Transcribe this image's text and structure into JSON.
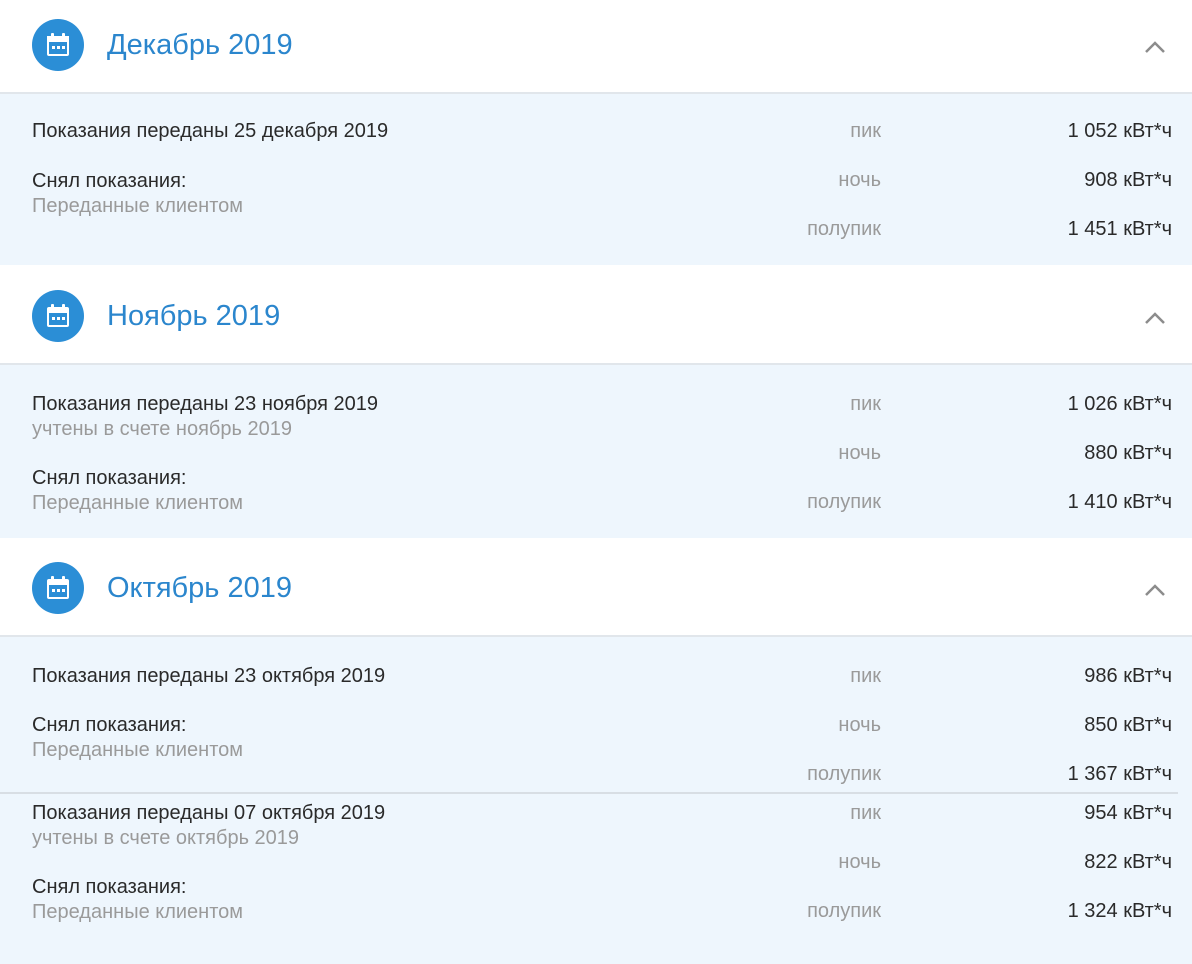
{
  "sections": [
    {
      "title": "Декабрь 2019",
      "entries": [
        {
          "submitted": "Показания переданы 25 декабря 2019",
          "counted": "",
          "reader_label": "Снял показания:",
          "reader_value": "Переданные клиентом",
          "readings": [
            {
              "zone": "пик",
              "value": "1 052 кВт*ч"
            },
            {
              "zone": "ночь",
              "value": "908 кВт*ч"
            },
            {
              "zone": "полупик",
              "value": "1 451 кВт*ч"
            }
          ]
        }
      ]
    },
    {
      "title": "Ноябрь 2019",
      "entries": [
        {
          "submitted": "Показания переданы 23 ноября 2019",
          "counted": "учтены в счете ноябрь 2019",
          "reader_label": "Снял показания:",
          "reader_value": "Переданные клиентом",
          "readings": [
            {
              "zone": "пик",
              "value": "1 026 кВт*ч"
            },
            {
              "zone": "ночь",
              "value": "880 кВт*ч"
            },
            {
              "zone": "полупик",
              "value": "1 410 кВт*ч"
            }
          ]
        }
      ]
    },
    {
      "title": "Октябрь 2019",
      "entries": [
        {
          "submitted": "Показания переданы 23 октября 2019",
          "counted": "",
          "reader_label": "Снял показания:",
          "reader_value": "Переданные клиентом",
          "readings": [
            {
              "zone": "пик",
              "value": "986 кВт*ч"
            },
            {
              "zone": "ночь",
              "value": "850 кВт*ч"
            },
            {
              "zone": "полупик",
              "value": "1 367 кВт*ч"
            }
          ]
        },
        {
          "submitted": "Показания переданы 07 октября 2019",
          "counted": "учтены в счете октябрь 2019",
          "reader_label": "Снял показания:",
          "reader_value": "Переданные клиентом",
          "readings": [
            {
              "zone": "пик",
              "value": "954 кВт*ч"
            },
            {
              "zone": "ночь",
              "value": "822 кВт*ч"
            },
            {
              "zone": "полупик",
              "value": "1 324 кВт*ч"
            }
          ]
        }
      ]
    }
  ]
}
